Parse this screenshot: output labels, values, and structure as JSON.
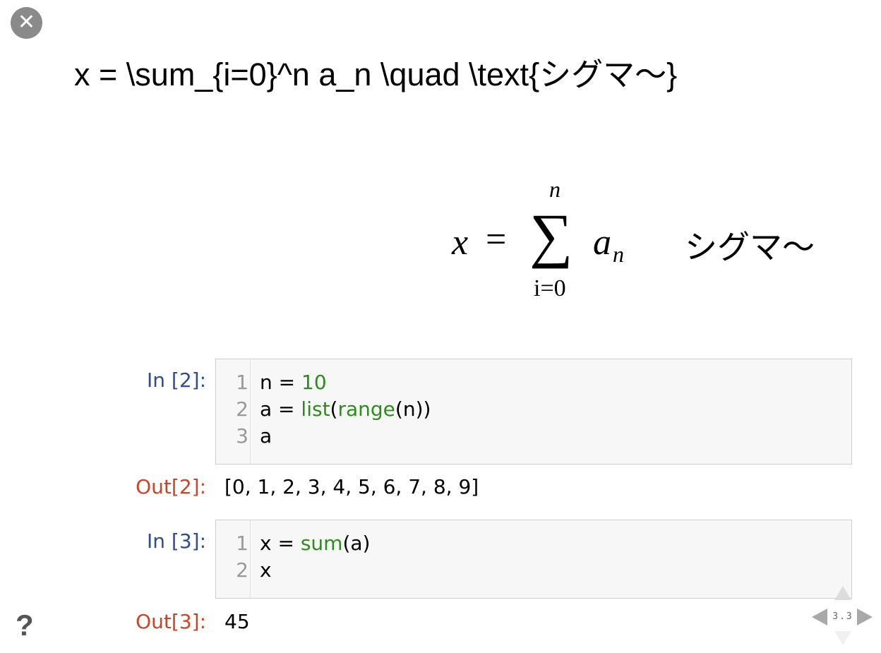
{
  "controls": {
    "close_glyph": "✕",
    "help_glyph": "?"
  },
  "slide": {
    "latex_source": "x = \\sum_{i=0}^n a_n \\quad \\text{シグマ〜}",
    "math": {
      "lhs": "x",
      "eq": "=",
      "sum_symbol": "∑",
      "upper": "n",
      "lower": "i=0",
      "term": "a",
      "subscript": "n",
      "text": "シグマ〜"
    }
  },
  "cells": [
    {
      "in_prompt": "In [2]:",
      "lines": [
        {
          "num": "1",
          "parts": [
            "n = ",
            "10"
          ]
        },
        {
          "num": "2",
          "parts": [
            "a = ",
            "list",
            "(",
            "range",
            "(n))"
          ]
        },
        {
          "num": "3",
          "parts": [
            "a"
          ]
        }
      ],
      "out_prompt": "Out[2]:",
      "output": "[0, 1, 2, 3, 4, 5, 6, 7, 8, 9]"
    },
    {
      "in_prompt": "In [3]:",
      "lines": [
        {
          "num": "1",
          "parts": [
            "x = ",
            "sum",
            "(a)"
          ]
        },
        {
          "num": "2",
          "parts": [
            "x"
          ]
        }
      ],
      "out_prompt": "Out[3]:",
      "output": "45"
    }
  ],
  "navigation": {
    "slide_number": "3.3",
    "icons": [
      "nav-up-icon",
      "nav-left-icon",
      "nav-right-icon",
      "nav-down-icon"
    ]
  }
}
